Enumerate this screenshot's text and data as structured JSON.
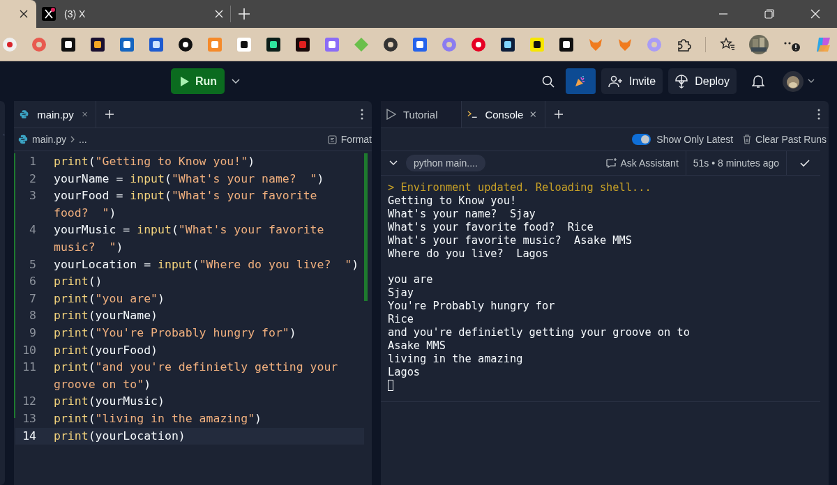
{
  "browser": {
    "tabs": [
      {
        "selected": true
      },
      {
        "title": "(3) X",
        "selected": false
      }
    ]
  },
  "toolbar": {
    "run": "Run",
    "invite": "Invite",
    "deploy": "Deploy"
  },
  "editor": {
    "tab": "main.py",
    "breadcrumb": "main.py",
    "breadcrumb_more": "...",
    "format": "Format",
    "lines": [
      {
        "number": "1",
        "rows": [
          "print(\"Getting to Know you!\")"
        ],
        "active": false
      },
      {
        "number": "2",
        "rows": [
          "yourName = input(\"What's your name?  \")"
        ],
        "active": false
      },
      {
        "number": "3",
        "rows": [
          "yourFood = input(\"What's your favorite",
          "food?  \")"
        ],
        "active": false
      },
      {
        "number": "4",
        "rows": [
          "yourMusic = input(\"What's your favorite",
          "music?  \")"
        ],
        "active": false
      },
      {
        "number": "5",
        "rows": [
          "yourLocation = input(\"Where do you live?  \")"
        ],
        "active": false
      },
      {
        "number": "6",
        "rows": [
          "print()"
        ],
        "active": false
      },
      {
        "number": "7",
        "rows": [
          "print(\"you are\")"
        ],
        "active": false
      },
      {
        "number": "8",
        "rows": [
          "print(yourName)"
        ],
        "active": false
      },
      {
        "number": "9",
        "rows": [
          "print(\"You're Probably hungry for\")"
        ],
        "active": false
      },
      {
        "number": "10",
        "rows": [
          "print(yourFood)"
        ],
        "active": false
      },
      {
        "number": "11",
        "rows": [
          "print(\"and you're definietly getting your",
          "groove on to\")"
        ],
        "active": false
      },
      {
        "number": "12",
        "rows": [
          "print(yourMusic)"
        ],
        "active": false
      },
      {
        "number": "13",
        "rows": [
          "print(\"living in the amazing\")"
        ],
        "active": false
      },
      {
        "number": "14",
        "rows": [
          "print(yourLocation)"
        ],
        "active": true
      }
    ]
  },
  "console": {
    "tabs": [
      {
        "label": "Tutorial",
        "kind": "tutorial",
        "selected": false
      },
      {
        "label": "Console",
        "kind": "console",
        "selected": true
      }
    ],
    "show_only_latest": {
      "label": "Show Only Latest",
      "on": true
    },
    "clear": "Clear Past Runs",
    "run": {
      "command": "python main....",
      "ask": "Ask Assistant",
      "time": "51s • 8 minutes ago"
    },
    "output": [
      {
        "kind": "system",
        "text": "> Environment updated. Reloading shell..."
      },
      {
        "kind": "output",
        "text": "Getting to Know you!"
      },
      {
        "kind": "output",
        "text": "What's your name?  Sjay"
      },
      {
        "kind": "output",
        "text": "What's your favorite food?  Rice"
      },
      {
        "kind": "output",
        "text": "What's your favorite music?  Asake MMS"
      },
      {
        "kind": "output",
        "text": "Where do you live?  Lagos"
      },
      {
        "kind": "blank"
      },
      {
        "kind": "output",
        "text": "you are"
      },
      {
        "kind": "output",
        "text": "Sjay"
      },
      {
        "kind": "output",
        "text": "You're Probably hungry for"
      },
      {
        "kind": "output",
        "text": "Rice"
      },
      {
        "kind": "output",
        "text": "and you're definietly getting your groove on to"
      },
      {
        "kind": "output",
        "text": "Asake MMS"
      },
      {
        "kind": "output",
        "text": "living in the amazing"
      },
      {
        "kind": "output",
        "text": "Lagos"
      },
      {
        "kind": "cursor"
      }
    ]
  }
}
